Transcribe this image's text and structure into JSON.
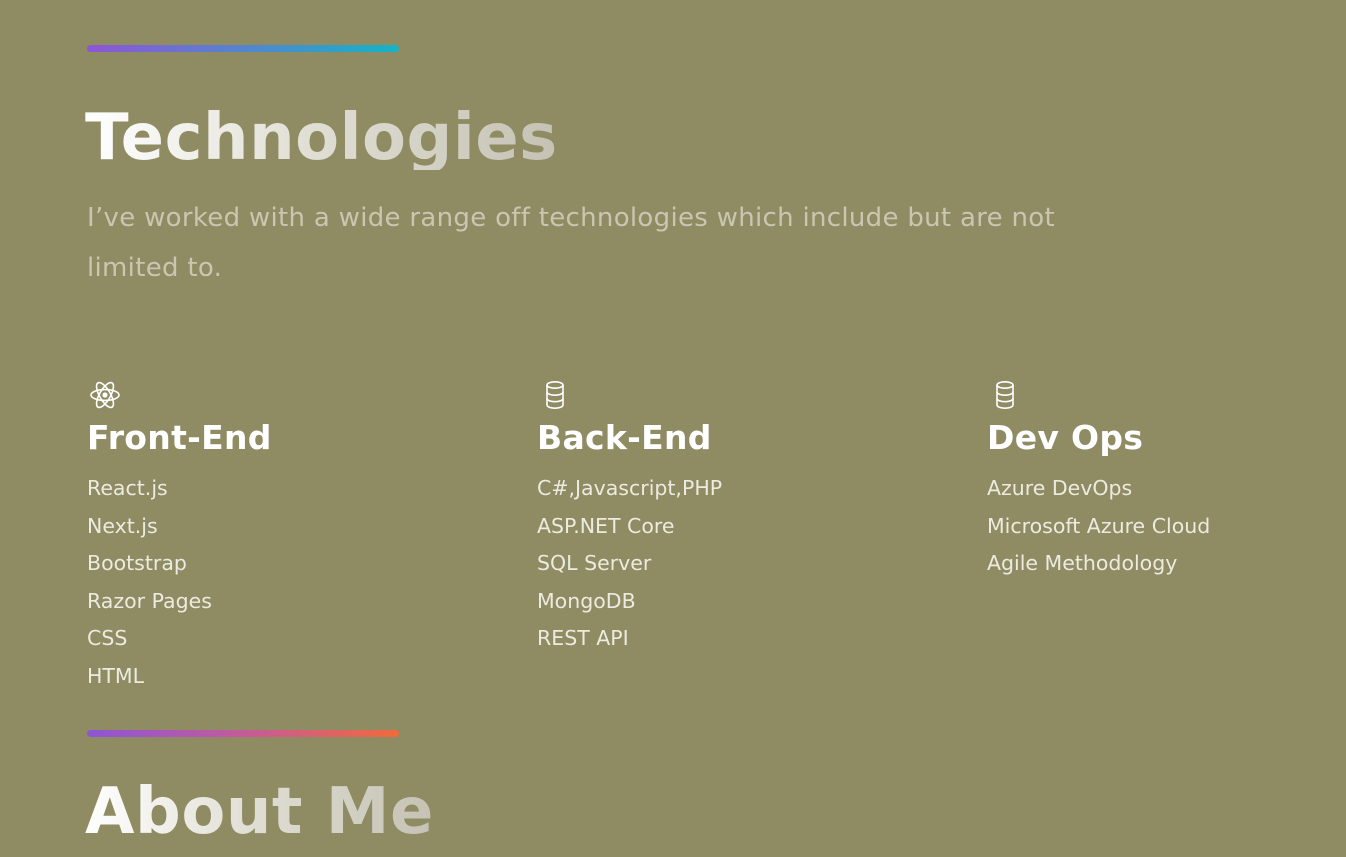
{
  "technologies": {
    "title": "Technologies",
    "subtitle": "I’ve worked with a wide range off technologies which include but are not limited to.",
    "columns": [
      {
        "icon": "react-atom-icon",
        "title": "Front-End",
        "items": [
          "React.js",
          "Next.js",
          "Bootstrap",
          "Razor Pages",
          "CSS",
          "HTML"
        ]
      },
      {
        "icon": "database-icon",
        "title": "Back-End",
        "items": [
          "C#,Javascript,PHP",
          "ASP.NET Core",
          "SQL Server",
          "MongoDB",
          "REST API"
        ]
      },
      {
        "icon": "database-icon",
        "title": "Dev Ops",
        "items": [
          "Azure DevOps",
          "Microsoft Azure Cloud",
          "Agile Methodology"
        ]
      }
    ]
  },
  "about": {
    "title": "About Me"
  },
  "colors": {
    "background": "#8f8b63",
    "divider_top_gradient": [
      "#8e55d6",
      "#5a80d0",
      "#14b4c6"
    ],
    "divider_bottom_gradient": [
      "#8e55d6",
      "#c45b9a",
      "#f06a3a"
    ],
    "heading_text": "#ffffff",
    "subtitle_text": "#c9c6b1",
    "list_text": "#ecebe0"
  }
}
